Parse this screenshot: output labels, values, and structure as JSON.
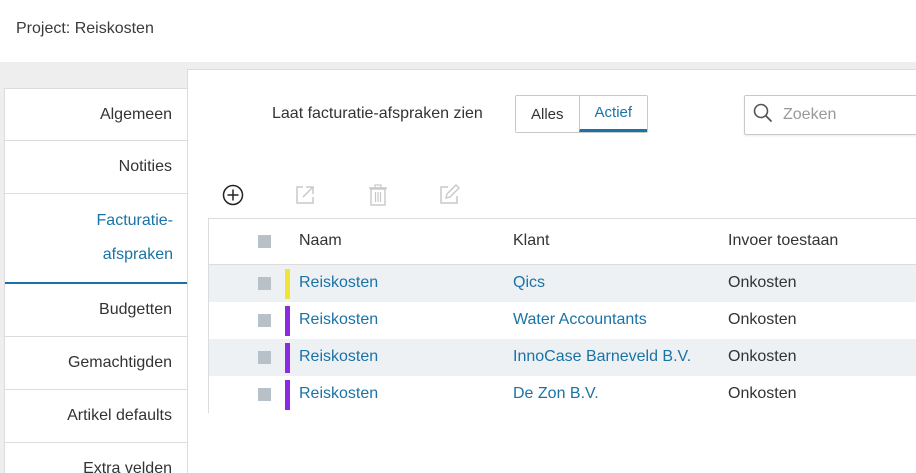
{
  "header": {
    "title": "Project: Reiskosten"
  },
  "sidebar": {
    "items": [
      {
        "label": "Algemeen"
      },
      {
        "label": "Notities"
      },
      {
        "label_line1": "Facturatie-",
        "label_line2": "afspraken",
        "active": true
      },
      {
        "label": "Budgetten"
      },
      {
        "label": "Gemachtigden"
      },
      {
        "label": "Artikel defaults"
      },
      {
        "label": "Extra velden"
      }
    ]
  },
  "filter": {
    "label": "Laat facturatie-afspraken zien",
    "options": [
      "Alles",
      "Actief"
    ],
    "selected": "Actief"
  },
  "search": {
    "placeholder": "Zoeken"
  },
  "toolbar": {
    "icons": [
      "add-circle-icon",
      "open-external-icon",
      "trash-icon",
      "edit-icon"
    ]
  },
  "table": {
    "columns": [
      "Naam",
      "Klant",
      "Invoer toestaan"
    ],
    "rows": [
      {
        "naam": "Reiskosten",
        "klant": "Qics",
        "invoer": "Onkosten",
        "color": "#f0e43a"
      },
      {
        "naam": "Reiskosten",
        "klant": "Water Accountants",
        "invoer": "Onkosten",
        "color": "#8a2be2"
      },
      {
        "naam": "Reiskosten",
        "klant": "InnoCase Barneveld B.V.",
        "invoer": "Onkosten",
        "color": "#8a2be2"
      },
      {
        "naam": "Reiskosten",
        "klant": "De Zon B.V.",
        "invoer": "Onkosten",
        "color": "#8a2be2"
      }
    ]
  },
  "colors": {
    "accent": "#1a73a6",
    "row_alt": "#eef1f4"
  }
}
